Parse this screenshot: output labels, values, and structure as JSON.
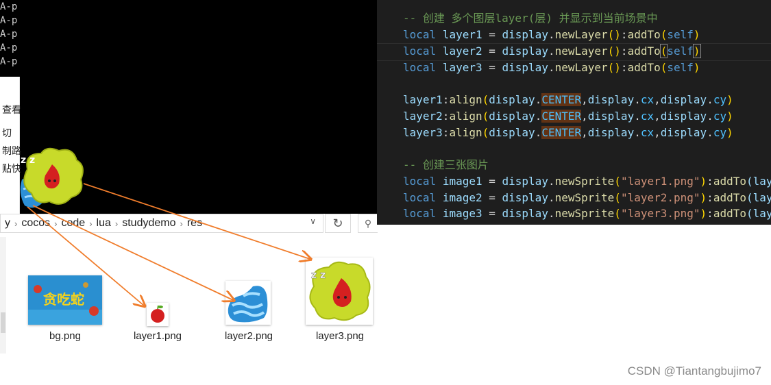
{
  "console": {
    "lines": [
      "A-p",
      "A-p",
      "A-p",
      "A-p",
      "A-p"
    ]
  },
  "explorer_left": {
    "labels": [
      "查看",
      "切",
      "制路",
      "贴快"
    ]
  },
  "breadcrumb": {
    "items": [
      "y",
      "cocos",
      "code",
      "lua",
      "studydemo",
      "res"
    ],
    "dropdown_icon": "chevron-down-icon",
    "refresh_icon": "refresh-icon"
  },
  "files": [
    {
      "name": "bg.png",
      "image_text": "贪吃蛇"
    },
    {
      "name": "layer1.png"
    },
    {
      "name": "layer2.png"
    },
    {
      "name": "layer3.png"
    }
  ],
  "editor": {
    "comment1": "-- 创建 多个图层layer(层) 并显示到当前场景中",
    "comment2": "-- 创建三张图片",
    "keyword_local": "local",
    "layers": [
      "layer1",
      "layer2",
      "layer3"
    ],
    "images": [
      "image1",
      "image2",
      "image3"
    ],
    "display": "display",
    "newLayer": "newLayer",
    "newSprite": "newSprite",
    "addTo": "addTo",
    "self": "self",
    "align": "align",
    "CENTER": "CENTER",
    "cx": "cx",
    "cy": "cy",
    "sprite_files": [
      "\"layer1.png\"",
      "\"layer2.png\"",
      "\"layer3.png\""
    ],
    "sprite_tail": "(lay"
  },
  "watermark": "CSDN @Tiantangbujimo7",
  "colors": {
    "arrow": "#f07d2c",
    "editor_bg": "#1e1e1e",
    "console_bg": "#000000"
  }
}
